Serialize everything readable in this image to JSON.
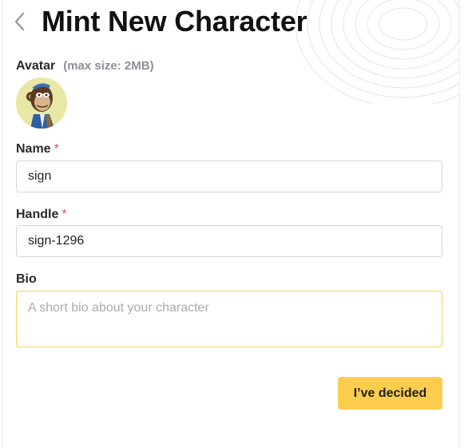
{
  "header": {
    "title": "Mint New Character",
    "back_icon": "chevron-left-icon"
  },
  "avatar": {
    "label": "Avatar",
    "hint": "(max size: 2MB)",
    "background": "#e8e7a6"
  },
  "name": {
    "label": "Name",
    "required_mark": "*",
    "value": "sign"
  },
  "handle": {
    "label": "Handle",
    "required_mark": "*",
    "value": "sign-1296"
  },
  "bio": {
    "label": "Bio",
    "placeholder": "A short bio about your character",
    "value": ""
  },
  "actions": {
    "submit_label": "I’ve decided"
  },
  "colors": {
    "accent": "#ffcd4d",
    "focus_border": "#f6d25a",
    "required": "#e5484d"
  }
}
